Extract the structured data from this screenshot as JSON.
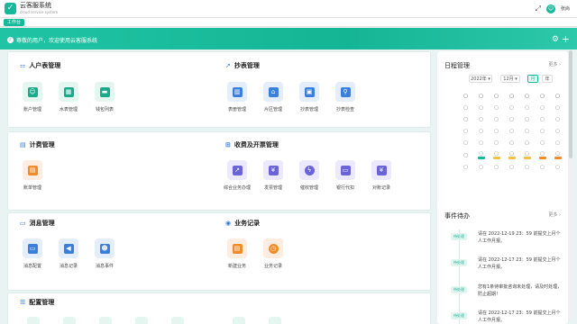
{
  "app": {
    "title": "云客服系统",
    "subtitle": "cloud service system",
    "user": "张尚"
  },
  "tabs": [
    {
      "label": "工作台"
    }
  ],
  "banner": {
    "text": "尊敬的用户，欢迎使用云客服系统"
  },
  "sections": {
    "renhu": {
      "title": "人户表管理",
      "items": [
        "账户管理",
        "水表管理",
        "钱包列表"
      ]
    },
    "chaobiao": {
      "title": "抄表管理",
      "items": [
        "表册管理",
        "片区管理",
        "抄表管理",
        "抄表检查"
      ]
    },
    "jifei": {
      "title": "计费管理",
      "items": [
        "账单管理"
      ]
    },
    "shoufei": {
      "title": "收费及开票管理",
      "items": [
        "综合业务办理",
        "发票管理",
        "催收管理",
        "银行代扣",
        "对账记录"
      ]
    },
    "xiaoxi": {
      "title": "消息管理",
      "items": [
        "消息配置",
        "消息记录",
        "消息事件"
      ]
    },
    "yewu": {
      "title": "业务记录",
      "items": [
        "新建业务",
        "业务记录"
      ]
    },
    "peizhi": {
      "title": "配置管理"
    }
  },
  "schedule": {
    "title": "日程管理",
    "more": "更多",
    "year": "2022年",
    "month": "12月",
    "view_month": "月",
    "view_year": "年"
  },
  "todos": {
    "title": "事件待办",
    "more": "更多",
    "items": [
      {
        "tag": "待处理",
        "text": "请在 2022-12-19 23：59 前提交上月个人工作月报。"
      },
      {
        "tag": "待处理",
        "text": "请在 2022-12-17 23：59 前提交上月个人工作月报。"
      },
      {
        "tag": "待处理",
        "text": "您有1条待审批咨询未处理，请及时处理，防止超期！"
      },
      {
        "tag": "待处理",
        "text": "请在 2022-12-17 23：59 前提交上月个人工作月报。"
      }
    ]
  },
  "colors": {
    "primary": "#15b89a",
    "accent_blue": "#2a7ad8",
    "accent_orange": "#f08c2e"
  }
}
